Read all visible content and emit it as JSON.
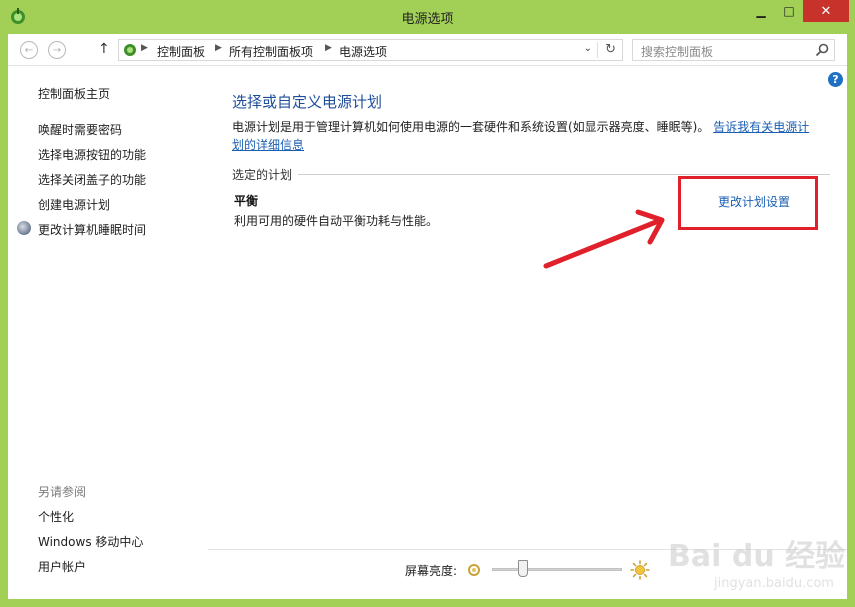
{
  "window": {
    "title": "电源选项",
    "minimize": "▁",
    "maximize": "□",
    "close": "✕"
  },
  "nav": {
    "back": "←",
    "forward": "→",
    "up": "↑",
    "breadcrumb": [
      "控制面板",
      "所有控制面板项",
      "电源选项"
    ],
    "search_placeholder": "搜索控制面板"
  },
  "sidebar": {
    "home": "控制面板主页",
    "items": [
      "唤醒时需要密码",
      "选择电源按钮的功能",
      "选择关闭盖子的功能",
      "创建电源计划",
      "更改计算机睡眠时间"
    ],
    "see_also_label": "另请参阅",
    "see_also": [
      "个性化",
      "Windows 移动中心",
      "用户帐户"
    ]
  },
  "main": {
    "title": "选择或自定义电源计划",
    "desc_text": "电源计划是用于管理计算机如何使用电源的一套硬件和系统设置(如显示器亮度、睡眠等)。",
    "desc_link": "告诉我有关电源计划的详细信息",
    "group_label": "选定的计划",
    "plan_name": "平衡",
    "plan_desc": "利用可用的硬件自动平衡功耗与性能。",
    "change_link": "更改计划设置"
  },
  "footer": {
    "brightness_label": "屏幕亮度:",
    "brightness_level": 0.25
  },
  "watermark": {
    "text": "Bai du 经验",
    "sub": "jingyan.baidu.com"
  },
  "colors": {
    "frame": "#a2d057",
    "link": "#1a5fb4",
    "title": "#1d4e9a",
    "annotation": "#e0202a"
  }
}
